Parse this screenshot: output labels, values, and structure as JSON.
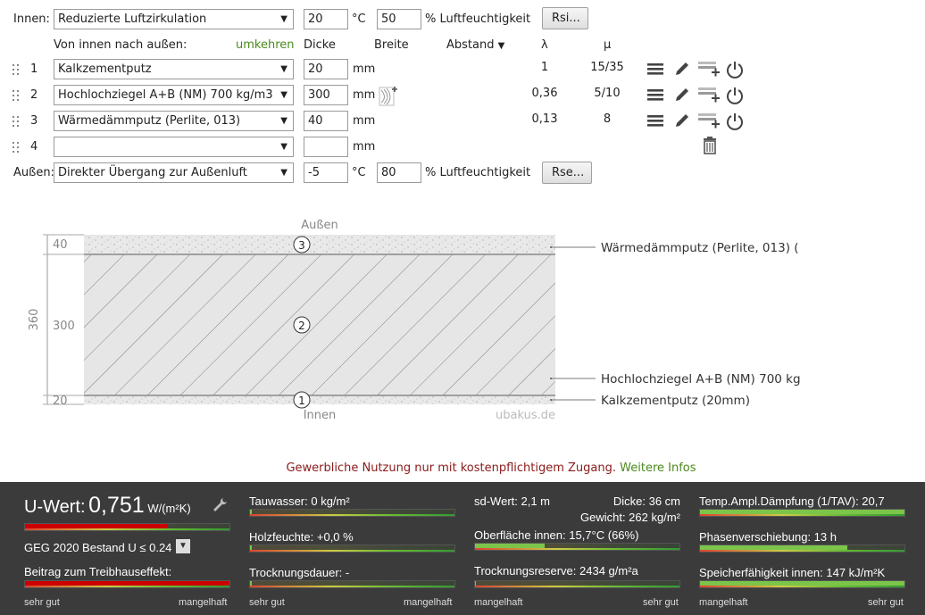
{
  "inside": {
    "label": "Innen:",
    "climate": "Reduzierte Luftzirkulation",
    "temp": "20",
    "temp_unit": "°C",
    "humidity": "50",
    "humidity_unit": "% Luftfeuchtigkeit",
    "rsi_button": "Rsi..."
  },
  "header": {
    "direction": "Von innen nach außen:",
    "reverse": "umkehren",
    "thickness": "Dicke",
    "width": "Breite",
    "spacing": "Abstand",
    "lambda": "λ",
    "mu": "μ"
  },
  "layers": [
    {
      "num": "1",
      "material": "Kalkzementputz",
      "thickness": "20",
      "unit": "mm",
      "lambda": "1",
      "mu": "15/35"
    },
    {
      "num": "2",
      "material": "Hochlochziegel A+B (NM) 700 kg/m3",
      "thickness": "300",
      "unit": "mm",
      "lambda": "0,36",
      "mu": "5/10"
    },
    {
      "num": "3",
      "material": "Wärmedämmputz (Perlite, 013)",
      "thickness": "40",
      "unit": "mm",
      "lambda": "0,13",
      "mu": "8"
    },
    {
      "num": "4",
      "material": "",
      "thickness": "",
      "unit": "mm",
      "lambda": "",
      "mu": ""
    }
  ],
  "outside": {
    "label": "Außen:",
    "climate": "Direkter Übergang zur Außenluft",
    "temp": "-5",
    "temp_unit": "°C",
    "humidity": "80",
    "humidity_unit": "% Luftfeuchtigkeit",
    "rse_button": "Rse..."
  },
  "diagram": {
    "top_label": "Außen",
    "bottom_label": "Innen",
    "watermark": "ubakus.de",
    "total": "360",
    "dims": [
      "40",
      "300",
      "20"
    ],
    "labels": [
      "Wärmedämmputz (Perlite, 013) (",
      "Hochlochziegel A+B (NM) 700 kg",
      "Kalkzementputz (20mm)"
    ],
    "markers": [
      "3",
      "2",
      "1"
    ]
  },
  "notice": {
    "text": "Gewerbliche Nutzung nur mit kostenpflichtigem Zugang.",
    "link": "Weitere Infos"
  },
  "results": {
    "uwert_label": "U-Wert:",
    "uwert_value": "0,751",
    "uwert_unit": "W/(m²K)",
    "geg": "GEG 2020 Bestand U ≤ 0.24",
    "treibhaus": "Beitrag zum Treibhauseffekt:",
    "tauwasser": "Tauwasser: 0 kg/m²",
    "holzfeuchte": "Holzfeuchte: +0,0 %",
    "trocknungsdauer": "Trocknungsdauer: -",
    "sd": "sd-Wert: 2,1 m",
    "dicke": "Dicke: 36 cm",
    "gewicht": "Gewicht: 262 kg/m²",
    "oberflaeche": "Oberfläche innen: 15,7°C (66%)",
    "reserve": "Trocknungsreserve: 2434 g/m²a",
    "tav": "Temp.Ampl.Dämpfung (1/TAV): 20,7",
    "phase": "Phasenverschiebung: 13 h",
    "speicher": "Speicherfähigkeit innen: 147 kJ/m²K",
    "scale_good": "sehr gut",
    "scale_bad": "mangelhaft",
    "meters": {
      "uwert": 0.7,
      "treibhaus": 1.0,
      "tauwasser": 0.01,
      "holzfeuchte": 0.01,
      "trocknung": 0.01,
      "oberflaeche": 0.34,
      "reserve": 0.0,
      "tav": 1.0,
      "phase": 0.72,
      "speicher": 1.0
    },
    "colors": {
      "bad": "#cc0000",
      "good": "#7cc44a",
      "bar_bg": "#3b3b3b"
    }
  }
}
